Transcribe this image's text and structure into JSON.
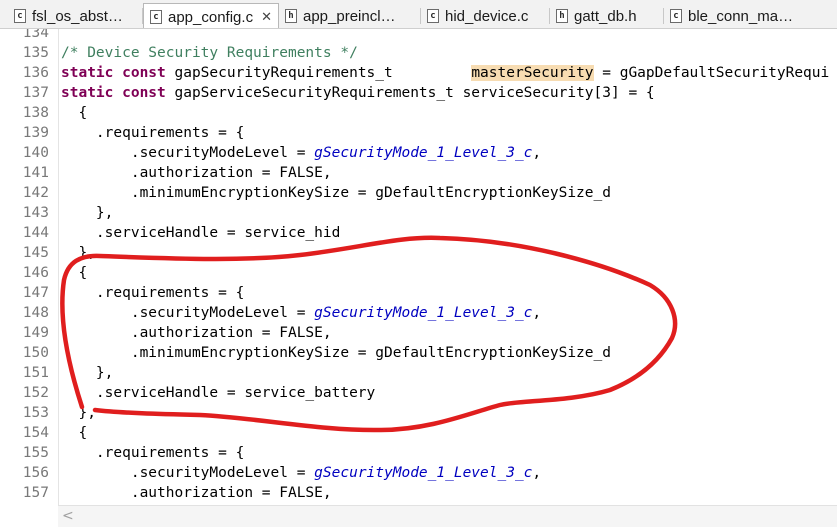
{
  "tabs": [
    {
      "label": "fsl_os_abst…",
      "icon": "c-file-icon",
      "icon_glyph": "c",
      "active": false
    },
    {
      "label": "app_config.c",
      "icon": "c-file-icon",
      "icon_glyph": "c",
      "active": true,
      "close": "✕"
    },
    {
      "label": "app_preincl…",
      "icon": "h-file-icon",
      "icon_glyph": "h",
      "active": false
    },
    {
      "label": "hid_device.c",
      "icon": "c-file-icon",
      "icon_glyph": "c",
      "active": false
    },
    {
      "label": "gatt_db.h",
      "icon": "h-file-icon",
      "icon_glyph": "h",
      "active": false
    },
    {
      "label": "ble_conn_ma…",
      "icon": "c-file-icon",
      "icon_glyph": "c",
      "active": false
    }
  ],
  "colors": {
    "keyword": "#7f0055",
    "comment": "#3f7f5f",
    "macro": "#0000c0",
    "highlight": "#f7dcb2",
    "annotation": "#e01e1e"
  },
  "editor": {
    "lines": [
      {
        "num": "134",
        "tokens": []
      },
      {
        "num": "135",
        "tokens": [
          {
            "t": "/* Device Security Requirements */",
            "c": "cm"
          }
        ]
      },
      {
        "num": "136",
        "tokens": [
          {
            "t": "static const",
            "c": "kw"
          },
          {
            "t": " gapSecurityRequirements_t         "
          },
          {
            "t": "masterSecurity",
            "c": "hl"
          },
          {
            "t": " = gGapDefaultSecurityRequi"
          }
        ]
      },
      {
        "num": "137",
        "tokens": [
          {
            "t": "static const",
            "c": "kw"
          },
          {
            "t": " gapServiceSecurityRequirements_t serviceSecurity[3] = {"
          }
        ]
      },
      {
        "num": "138",
        "tokens": [
          {
            "t": "  {"
          }
        ]
      },
      {
        "num": "139",
        "tokens": [
          {
            "t": "    .requirements = {"
          }
        ]
      },
      {
        "num": "140",
        "tokens": [
          {
            "t": "        .securityModeLevel = "
          },
          {
            "t": "gSecurityMode_1_Level_3_c",
            "c": "mac"
          },
          {
            "t": ","
          }
        ]
      },
      {
        "num": "141",
        "tokens": [
          {
            "t": "        .authorization = FALSE,"
          }
        ]
      },
      {
        "num": "142",
        "tokens": [
          {
            "t": "        .minimumEncryptionKeySize = gDefaultEncryptionKeySize_d"
          }
        ]
      },
      {
        "num": "143",
        "tokens": [
          {
            "t": "    },"
          }
        ]
      },
      {
        "num": "144",
        "tokens": [
          {
            "t": "    .serviceHandle = service_hid"
          }
        ]
      },
      {
        "num": "145",
        "tokens": [
          {
            "t": "  },"
          }
        ]
      },
      {
        "num": "146",
        "tokens": [
          {
            "t": "  {"
          }
        ]
      },
      {
        "num": "147",
        "tokens": [
          {
            "t": "    .requirements = {"
          }
        ]
      },
      {
        "num": "148",
        "tokens": [
          {
            "t": "        .securityModeLevel = "
          },
          {
            "t": "gSecurityMode_1_Level_3_c",
            "c": "mac"
          },
          {
            "t": ","
          }
        ]
      },
      {
        "num": "149",
        "tokens": [
          {
            "t": "        .authorization = FALSE,"
          }
        ]
      },
      {
        "num": "150",
        "tokens": [
          {
            "t": "        .minimumEncryptionKeySize = gDefaultEncryptionKeySize_d"
          }
        ]
      },
      {
        "num": "151",
        "tokens": [
          {
            "t": "    },"
          }
        ]
      },
      {
        "num": "152",
        "tokens": [
          {
            "t": "    .serviceHandle = service_battery"
          }
        ]
      },
      {
        "num": "153",
        "tokens": [
          {
            "t": "  },"
          }
        ]
      },
      {
        "num": "154",
        "tokens": [
          {
            "t": "  {"
          }
        ]
      },
      {
        "num": "155",
        "tokens": [
          {
            "t": "    .requirements = {"
          }
        ]
      },
      {
        "num": "156",
        "tokens": [
          {
            "t": "        .securityModeLevel = "
          },
          {
            "t": "gSecurityMode_1_Level_3_c",
            "c": "mac"
          },
          {
            "t": ","
          }
        ]
      },
      {
        "num": "157",
        "tokens": [
          {
            "t": "        .authorization = FALSE,"
          }
        ]
      }
    ]
  },
  "scrollbar": {
    "left_arrow": "<"
  }
}
